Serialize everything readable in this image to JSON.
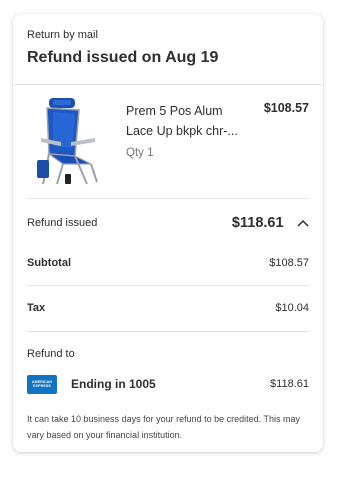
{
  "header": {
    "subtitle": "Return by mail",
    "title": "Refund issued on Aug 19"
  },
  "item": {
    "name_line1": "Prem 5 Pos Alum",
    "name_line2": "Lace Up bkpk chr-...",
    "price": "$108.57",
    "qty": "Qty 1",
    "image_icon": "beach-chair-image"
  },
  "refund": {
    "label": "Refund issued",
    "total": "$118.61",
    "subtotal_label": "Subtotal",
    "subtotal": "$108.57",
    "tax_label": "Tax",
    "tax": "$10.04",
    "refund_to_label": "Refund to",
    "card_brand_line1": "AMERICAN",
    "card_brand_line2": "EXPRESS",
    "card_ending": "Ending in 1005",
    "card_amount": "$118.61"
  },
  "note": "It can take 10 business days for your refund to be credited. This may vary based on your financial institution.",
  "colors": {
    "amex_blue": "#1273c3",
    "divider": "#e3e4e5",
    "text": "#2e2f32",
    "muted": "#74767c"
  }
}
